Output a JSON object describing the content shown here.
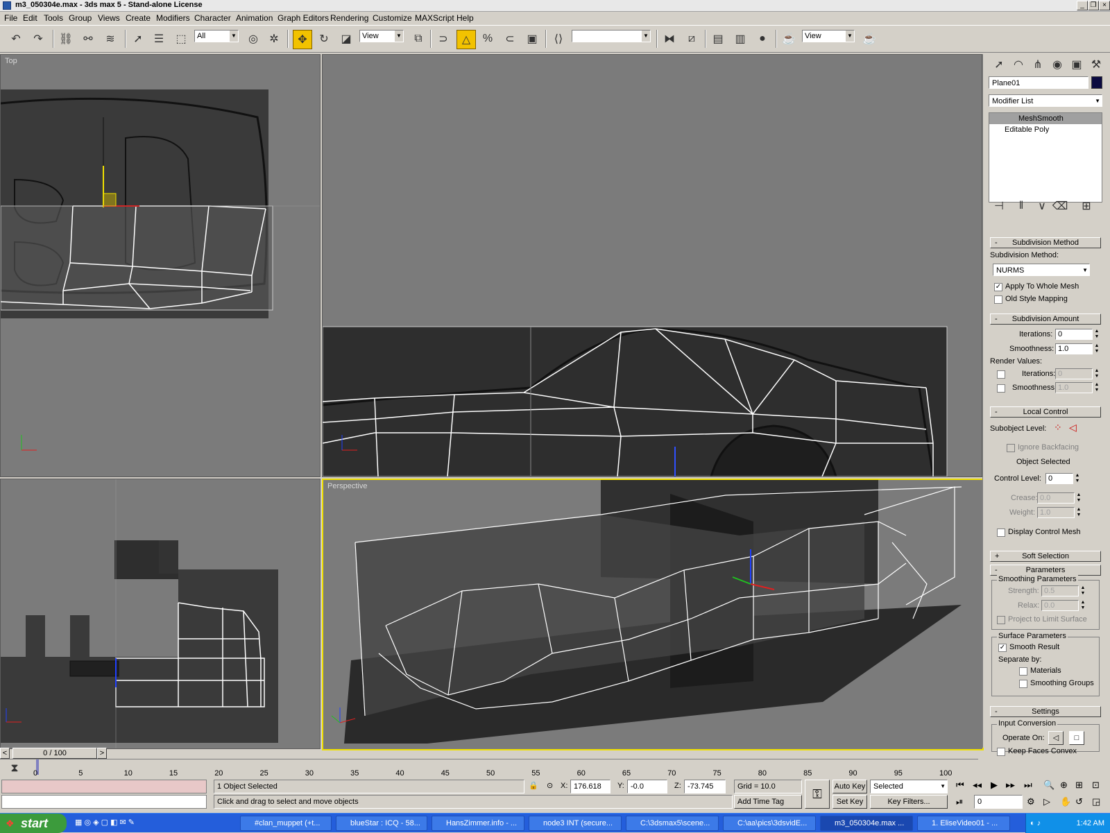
{
  "title_bar": {
    "title": "m3_050304e.max - 3ds max 5 - Stand-alone License"
  },
  "menu": [
    "File",
    "Edit",
    "Tools",
    "Group",
    "Views",
    "Create",
    "Modifiers",
    "Character",
    "Animation",
    "Graph Editors",
    "Rendering",
    "Customize",
    "MAXScript",
    "Help"
  ],
  "toolbar": {
    "selection_filter": "All",
    "ref_coord": "View",
    "named_selection": "",
    "render_view": "View"
  },
  "viewports": {
    "top_label": "Top",
    "perspective_label": "Perspective"
  },
  "command_panel": {
    "object_name": "Plane01",
    "modifier_list": "Modifier List",
    "stack": [
      "MeshSmooth",
      "Editable Poly"
    ],
    "subdivision_method": {
      "header": "Subdivision Method",
      "label": "Subdivision Method:",
      "value": "NURMS",
      "apply_whole": "Apply To Whole Mesh",
      "old_style": "Old Style Mapping"
    },
    "subdivision_amount": {
      "header": "Subdivision Amount",
      "iterations_label": "Iterations:",
      "iterations": "0",
      "smoothness_label": "Smoothness:",
      "smoothness": "1.0",
      "render_values": "Render Values:",
      "r_iterations_label": "Iterations:",
      "r_iterations": "0",
      "r_smoothness_label": "Smoothness:",
      "r_smoothness": "1.0"
    },
    "local_control": {
      "header": "Local Control",
      "subobject_label": "Subobject Level:",
      "ignore_backfacing": "Ignore Backfacing",
      "object_selected": "Object Selected",
      "control_level_label": "Control Level:",
      "control_level": "0",
      "crease_label": "Crease:",
      "crease": "0.0",
      "weight_label": "Weight:",
      "weight": "1.0",
      "display_control_mesh": "Display Control Mesh"
    },
    "soft_selection": {
      "header": "Soft Selection"
    },
    "parameters": {
      "header": "Parameters",
      "smoothing_params": "Smoothing Parameters",
      "strength_label": "Strength:",
      "strength": "0.5",
      "relax_label": "Relax:",
      "relax": "0.0",
      "project": "Project to Limit Surface",
      "surface_params": "Surface Parameters",
      "smooth_result": "Smooth Result",
      "separate_by": "Separate by:",
      "materials": "Materials",
      "smoothing_groups": "Smoothing Groups"
    },
    "settings": {
      "header": "Settings",
      "input_conversion": "Input Conversion",
      "operate_on": "Operate On:",
      "keep_faces_convex": "Keep Faces Convex"
    }
  },
  "timeline": {
    "frame": "0 / 100",
    "ticks": [
      "0",
      "5",
      "10",
      "15",
      "20",
      "25",
      "30",
      "35",
      "40",
      "45",
      "50",
      "55",
      "60",
      "65",
      "70",
      "75",
      "80",
      "85",
      "90",
      "95",
      "100"
    ]
  },
  "status": {
    "selected_text": "1 Object Selected",
    "prompt": "Click and drag to select and move objects",
    "x_label": "X:",
    "x": "176.618",
    "y_label": "Y:",
    "y": "-0.0",
    "z_label": "Z:",
    "z": "-73.745",
    "grid": "Grid = 10.0",
    "add_time_tag": "Add Time Tag",
    "auto_key": "Auto Key",
    "set_key": "Set Key",
    "key_mode": "Selected",
    "key_filters": "Key Filters...",
    "current_frame": "0"
  },
  "taskbar": {
    "start": "start",
    "tasks": [
      "#clan_muppet (+t...",
      "blueStar : ICQ - 58...",
      "HansZimmer.info - ...",
      "node3 INT (secure...",
      "C:\\3dsmax5\\scene...",
      "C:\\aa\\pics\\3dsvidE...",
      "m3_050304e.max ...",
      "1. EliseVideo01 - ..."
    ],
    "clock": "1:42 AM"
  }
}
